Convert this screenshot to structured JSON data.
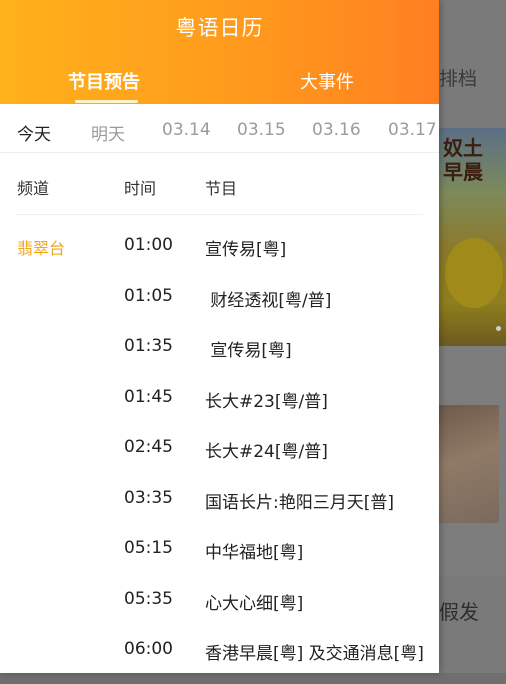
{
  "background": {
    "tab_label": "排档",
    "poster_text": "奴土\n早晨",
    "bottom_word": "假发"
  },
  "header": {
    "title": "粤语日历",
    "tabs": [
      {
        "label": "节目预告",
        "active": true
      },
      {
        "label": "大事件",
        "active": false
      }
    ],
    "gradient_colors": [
      "#ffb11b",
      "#ff7f21"
    ]
  },
  "dates": [
    {
      "label": "今天",
      "active": true
    },
    {
      "label": "明天",
      "active": false
    },
    {
      "label": "03.14",
      "active": false
    },
    {
      "label": "03.15",
      "active": false
    },
    {
      "label": "03.16",
      "active": false
    },
    {
      "label": "03.17",
      "active": false
    }
  ],
  "columns": {
    "channel": "频道",
    "time": "时间",
    "program": "节目"
  },
  "channel": {
    "name": "翡翠台",
    "color": "#f0a51c"
  },
  "schedule": [
    {
      "time": "01:00",
      "program": "宣传易[粤]"
    },
    {
      "time": "01:05",
      "program": " 财经透视[粤/普]"
    },
    {
      "time": "01:35",
      "program": " 宣传易[粤]"
    },
    {
      "time": "01:45",
      "program": "长大#23[粤/普]"
    },
    {
      "time": "02:45",
      "program": "长大#24[粤/普]"
    },
    {
      "time": "03:35",
      "program": "国语长片:艳阳三月天[普]"
    },
    {
      "time": "05:15",
      "program": "中华福地[粤]"
    },
    {
      "time": "05:35",
      "program": "心大心细[粤]"
    },
    {
      "time": "06:00",
      "program": "香港早晨[粤] 及交通消息[粤]"
    }
  ]
}
